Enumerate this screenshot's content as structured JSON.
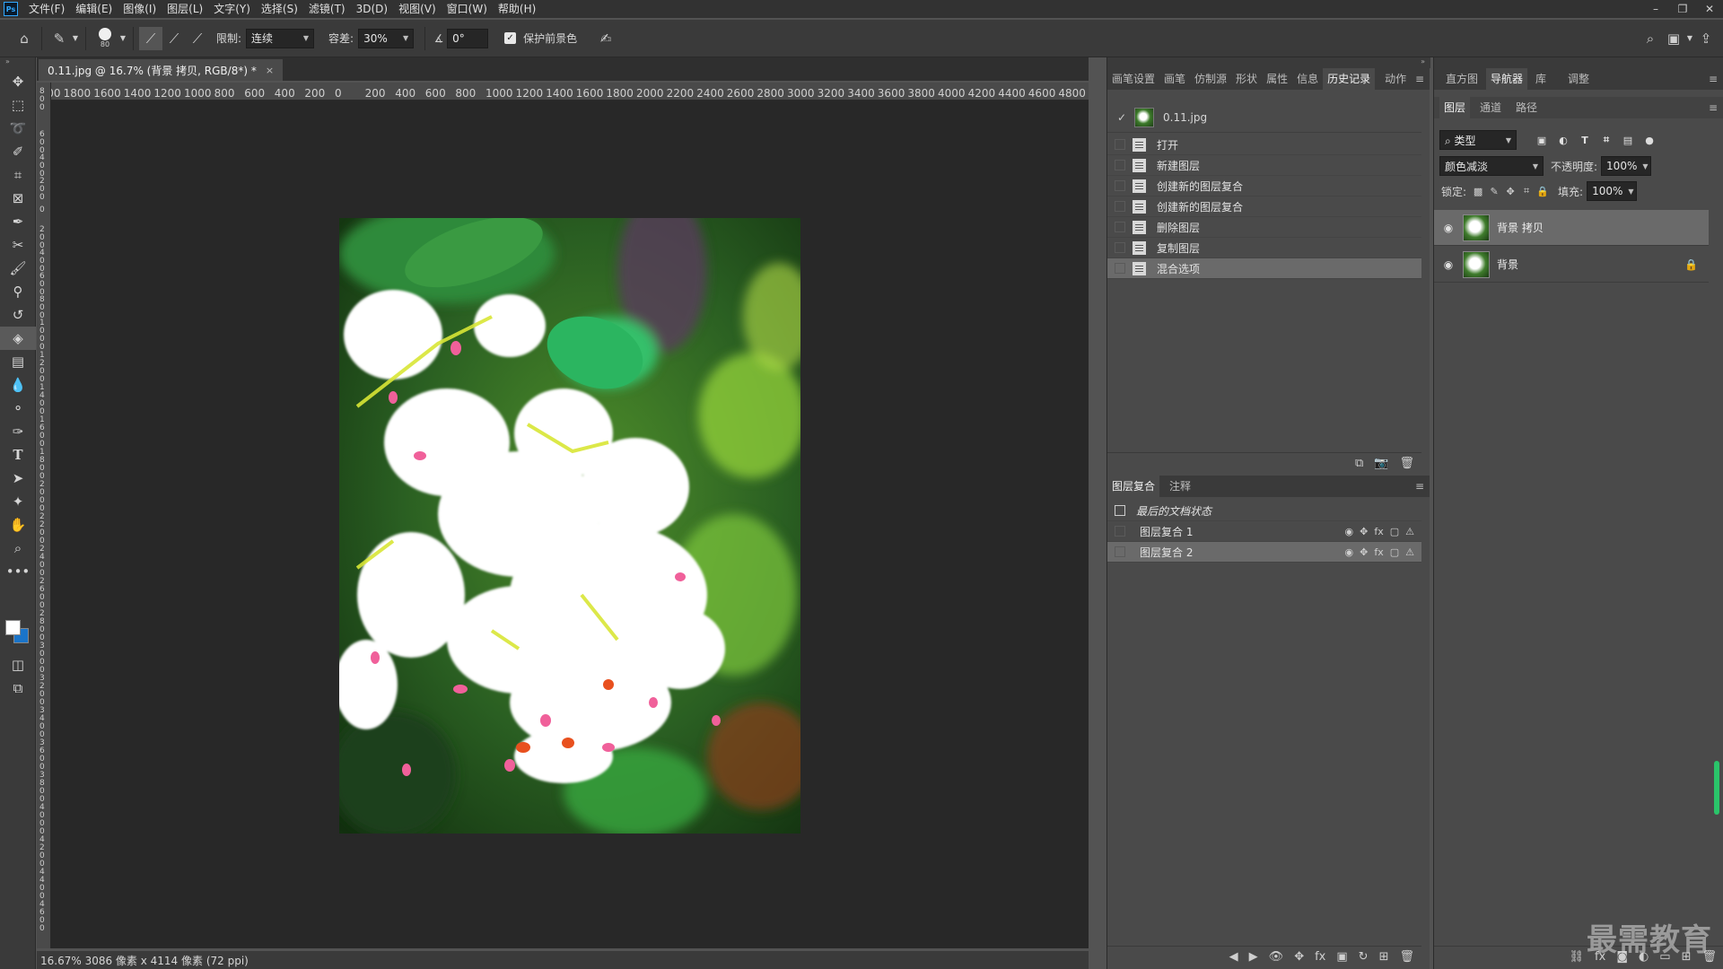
{
  "app": {
    "logo_text": "Ps",
    "menus": [
      "文件(F)",
      "编辑(E)",
      "图像(I)",
      "图层(L)",
      "文字(Y)",
      "选择(S)",
      "滤镜(T)",
      "3D(D)",
      "视图(V)",
      "窗口(W)",
      "帮助(H)"
    ],
    "window_controls": {
      "minimize": "–",
      "restore": "❐",
      "close": "✕"
    }
  },
  "options": {
    "brush_size": "80",
    "limit_label": "限制:",
    "limit_value": "连续",
    "tolerance_label": "容差:",
    "tolerance_value": "30%",
    "angle_value": "0°",
    "protect_fg_label": "保护前景色",
    "protect_fg_checked": "✓"
  },
  "document": {
    "tab_title": "0.11.jpg @ 16.7% (背景 拷贝, RGB/8*) *",
    "close": "×",
    "ruler_h": [
      "2000",
      "1800",
      "1600",
      "1400",
      "1200",
      "1000",
      "800",
      "600",
      "400",
      "200",
      "0",
      "200",
      "400",
      "600",
      "800",
      "1000",
      "1200",
      "1400",
      "1600",
      "1800",
      "2000",
      "2200",
      "2400",
      "2600",
      "2800",
      "3000",
      "3200",
      "3400",
      "3600",
      "3800",
      "4000",
      "4200",
      "4400",
      "4600",
      "4800"
    ],
    "status": "16.67%  3086 像素 x 4114 像素 (72 ppi)"
  },
  "history_panel": {
    "tabs": [
      "画笔设置",
      "画笔",
      "仿制源",
      "形状",
      "属性",
      "信息",
      "历史记录",
      "动作"
    ],
    "active_tab": 6,
    "snapshot_name": "0.11.jpg",
    "items": [
      {
        "label": "打开"
      },
      {
        "label": "新建图层"
      },
      {
        "label": "创建新的图层复合"
      },
      {
        "label": "创建新的图层复合"
      },
      {
        "label": "删除图层"
      },
      {
        "label": "复制图层"
      },
      {
        "label": "混合选项"
      }
    ]
  },
  "comps_panel": {
    "tabs": [
      "图层复合",
      "注释"
    ],
    "last_state": "最后的文档状态",
    "comps": [
      {
        "label": "图层复合 1"
      },
      {
        "label": "图层复合 2"
      }
    ]
  },
  "right_panel": {
    "top_tabs": [
      "直方图",
      "导航器",
      "库",
      "调整"
    ],
    "layer_tabs": [
      "图层",
      "通道",
      "路径"
    ],
    "filter_kind": "类型",
    "blend_mode": "颜色减淡",
    "opacity_label": "不透明度:",
    "opacity_value": "100%",
    "lock_label": "锁定:",
    "fill_label": "填充:",
    "fill_value": "100%",
    "layers": [
      {
        "name": "背景 拷贝",
        "locked": false
      },
      {
        "name": "背景",
        "locked": true
      }
    ]
  },
  "watermark": "最需教育",
  "colors": {
    "foreground": "#ffffff",
    "background": "#1a74c9",
    "accent": "#31a8ff"
  }
}
